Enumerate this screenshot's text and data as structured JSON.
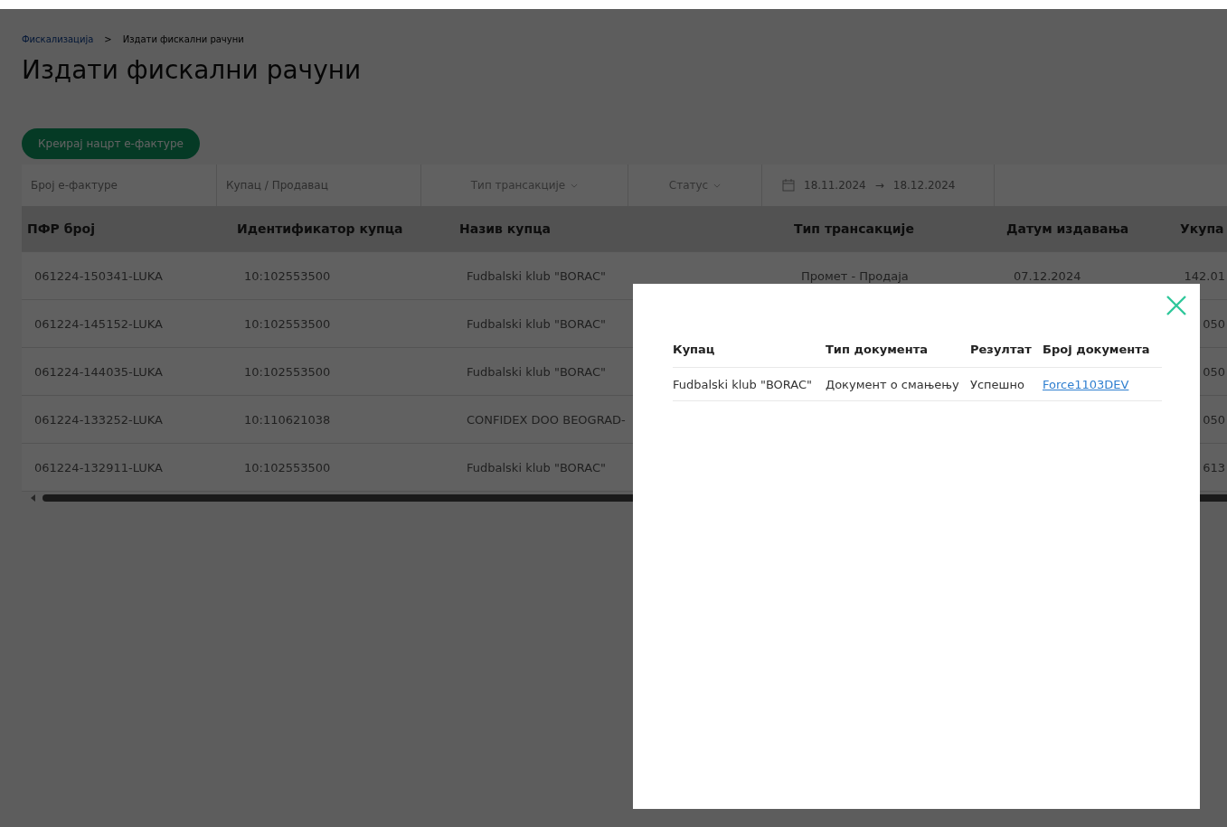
{
  "breadcrumb": [
    {
      "label": "Фискализација",
      "link": true
    },
    {
      "label": ">",
      "link": false
    },
    {
      "label": "Издати фискални рачуни",
      "link": false
    }
  ],
  "title": "Издати фискални рачуни",
  "create_button": "Креирај нацрт е-фактуре",
  "filters": [
    {
      "kind": "text",
      "placeholder": "Број е-фактуре"
    },
    {
      "kind": "text",
      "placeholder": "Купац / Продавац"
    },
    {
      "kind": "select",
      "label": "Тип трансакције"
    },
    {
      "kind": "select",
      "label": "Статус"
    },
    {
      "kind": "daterange",
      "from": "18.11.2024",
      "arrow": "→",
      "to": "18.12.2024"
    }
  ],
  "table": {
    "columns": [
      "ПФР број",
      "Идентификатор купца",
      "Назив купца",
      "Тип трансакције",
      "Датум издавања",
      "Укупа"
    ],
    "rows": [
      {
        "pfr": "061224-150341-LUKA",
        "buyer_id": "10:102553500",
        "buyer_name": "Fudbalski klub \"BORAC\"",
        "transaction_type": "Промет - Продаја",
        "date": "07.12.2024",
        "total": "142.01"
      },
      {
        "pfr": "061224-145152-LUKA",
        "buyer_id": "10:102553500",
        "buyer_name": "Fudbalski klub \"BORAC\"",
        "total": "050"
      },
      {
        "pfr": "061224-144035-LUKA",
        "buyer_id": "10:102553500",
        "buyer_name": "Fudbalski klub \"BORAC\"",
        "total": "050"
      },
      {
        "pfr": "061224-133252-LUKA",
        "buyer_id": "10:110621038",
        "buyer_name": "CONFIDEX DOO BEOGRAD-",
        "total": "050"
      },
      {
        "pfr": "061224-132911-LUKA",
        "buyer_id": "10:102553500",
        "buyer_name": "Fudbalski klub \"BORAC\"",
        "total": "613"
      }
    ]
  },
  "modal": {
    "columns": [
      "Купац",
      "Тип документа",
      "Резултат",
      "Број документа"
    ],
    "rows": [
      {
        "buyer": "Fudbalski klub \"BORAC\"",
        "document_type": "Документ о смањењу",
        "result": "Успешно",
        "document_number": "Force1103DEV"
      }
    ]
  }
}
